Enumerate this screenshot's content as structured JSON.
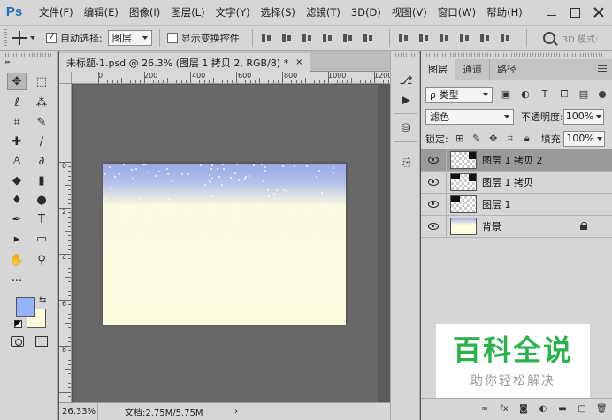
{
  "app": {
    "logo": "Ps"
  },
  "menu": [
    "文件(F)",
    "编辑(E)",
    "图像(I)",
    "图层(L)",
    "文字(Y)",
    "选择(S)",
    "滤镜(T)",
    "3D(D)",
    "视图(V)",
    "窗口(W)",
    "帮助(H)"
  ],
  "options": {
    "auto_select_label": "自动选择:",
    "auto_select_value": "图层",
    "show_transform_label": "显示变换控件",
    "mode_3d": "3D 模式:"
  },
  "document": {
    "tab_title": "未标题-1.psd @ 26.3% (图层 1 拷贝 2, RGB/8) *",
    "close": "×"
  },
  "ruler_h_labels": [
    "0",
    "200",
    "400",
    "600",
    "800",
    "1000",
    "1200"
  ],
  "ruler_v_labels": [
    "0",
    "2",
    "4",
    "6",
    "8"
  ],
  "status": {
    "zoom": "26.33%",
    "doc_size": "文档:2.75M/5.75M",
    "arrow": "›"
  },
  "layers_panel": {
    "tabs": [
      "图层",
      "通道",
      "路径"
    ],
    "filter_type": "ρ 类型",
    "blend_mode": "滤色",
    "opacity_label": "不透明度:",
    "opacity_value": "100%",
    "lock_label": "锁定:",
    "fill_label": "填充:",
    "fill_value": "100%",
    "layers": [
      {
        "name": "图层 1 拷贝 2",
        "selected": true,
        "type": "pattern"
      },
      {
        "name": "图层 1 拷贝",
        "selected": false,
        "type": "pattern"
      },
      {
        "name": "图层 1",
        "selected": false,
        "type": "pattern"
      },
      {
        "name": "背景",
        "selected": false,
        "type": "background",
        "locked": true
      }
    ]
  },
  "watermark": {
    "title": "百科全说",
    "subtitle": "助你轻松解决"
  },
  "colors": {
    "foreground": "#93b4f8",
    "background": "#fbfbde",
    "canvas_top": "#99a9e8",
    "canvas_bottom": "#fcfcdf",
    "watermark_green": "#2bb24c"
  },
  "tool_icons": [
    "move-tool-icon",
    "marquee-tool-icon",
    "lasso-tool-icon",
    "magic-wand-icon",
    "crop-tool-icon",
    "eyedropper-icon",
    "healing-brush-icon",
    "brush-tool-icon",
    "clone-stamp-icon",
    "history-brush-icon",
    "eraser-icon",
    "gradient-icon",
    "blur-icon",
    "dodge-icon",
    "pen-tool-icon",
    "type-tool-icon",
    "path-select-icon",
    "rectangle-tool-icon",
    "hand-tool-icon",
    "zoom-tool-icon",
    "more-tools-icon"
  ]
}
